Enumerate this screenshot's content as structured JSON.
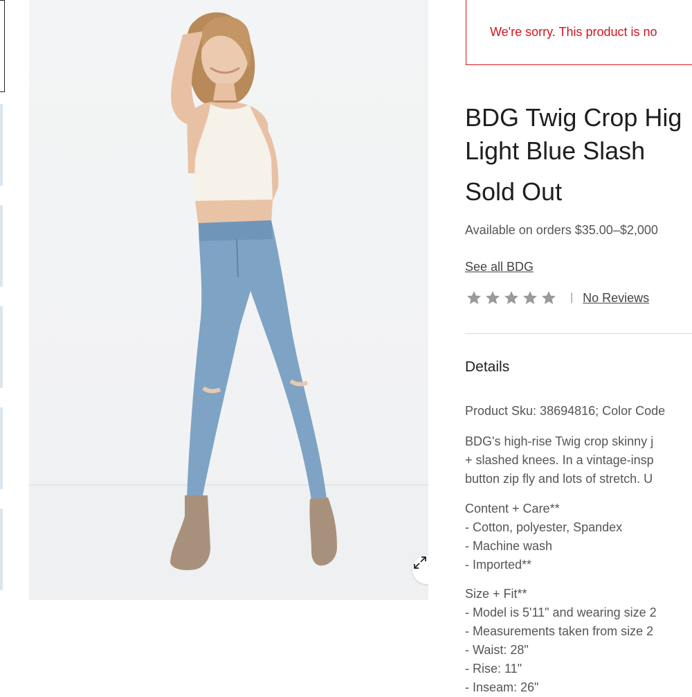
{
  "gallery": {
    "thumbnail_count": 6,
    "expand_icon": "expand-arrows-icon"
  },
  "notice": {
    "text": "We're sorry. This product is no"
  },
  "product": {
    "title_line1": "BDG Twig Crop Hig",
    "title_line2": "Light Blue Slash",
    "status": "Sold Out",
    "availability": "Available on orders $35.00–$2,000",
    "brand_link": "See all BDG",
    "rating_stars": 0,
    "rating_max": 5,
    "rating_separator": "|",
    "reviews_link": "No Reviews"
  },
  "details": {
    "heading": "Details",
    "sku_line": "Product Sku: 38694816; Color Code",
    "description": [
      "BDG's high-rise Twig crop skinny j",
      "+ slashed knees. In a vintage-insp",
      "button zip fly and lots of stretch. U"
    ],
    "content_care": [
      "Content + Care**",
      "- Cotton, polyester, Spandex",
      "- Machine wash",
      "- Imported**"
    ],
    "size_fit": [
      "Size + Fit**",
      "- Model is 5'11\" and wearing size 2",
      "- Measurements taken from size 2",
      "- Waist: 28\"",
      "- Rise: 11\"",
      "- Inseam: 26\""
    ]
  },
  "colors": {
    "alert_red": "#d4141c",
    "text_dark": "#1e1e1e",
    "text_gray": "#555555",
    "star_gray": "#9a9a9a",
    "denim": "#7ea3c4"
  }
}
